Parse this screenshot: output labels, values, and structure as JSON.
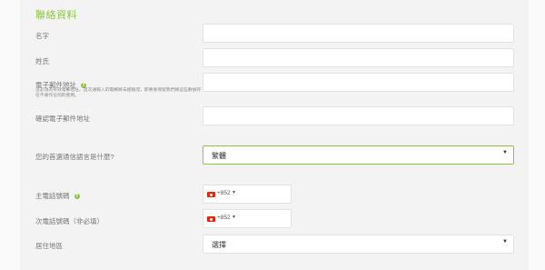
{
  "section": {
    "title": "聯絡資料"
  },
  "fields": {
    "first_name": {
      "label": "名字",
      "value": ""
    },
    "last_name": {
      "label": "姓氏",
      "value": ""
    },
    "email": {
      "label": "電子郵件地址",
      "hint": "這必須為有效電郵地址。首次通報入的電郵將未經驗證，即將會保留我們將這些數據存在不會作任何的使用。",
      "value": ""
    },
    "confirm_email": {
      "label": "確認電子郵件地址",
      "value": ""
    },
    "language": {
      "label": "您的首選通信語言是什麼?",
      "value": "繁體"
    },
    "primary_phone": {
      "label": "主電話號碼",
      "country_code": "+852"
    },
    "secondary_phone": {
      "label": "次電話號碼（非必填）",
      "country_code": "+852"
    },
    "region": {
      "label": "居住地區",
      "value": "選擇"
    }
  },
  "icons": {
    "help": "question-circle-icon",
    "dropdown": "chevron-down-icon",
    "flag": "hong-kong-flag-icon"
  },
  "colors": {
    "accent": "#8cc63f",
    "flag_red": "#de2910"
  }
}
